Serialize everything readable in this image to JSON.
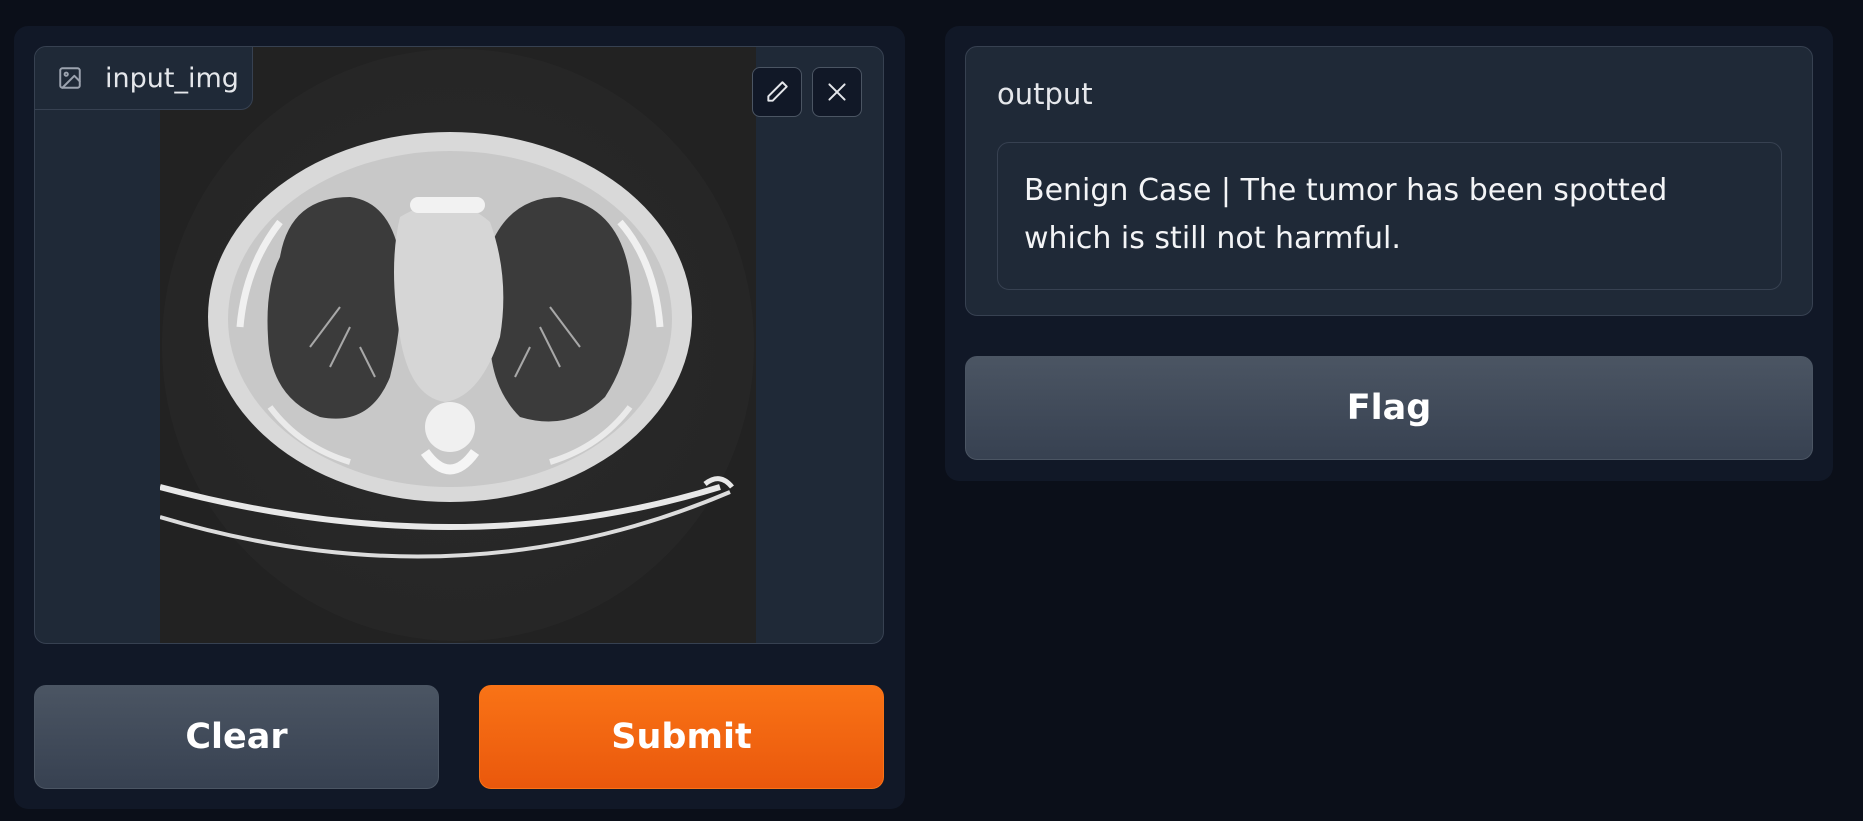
{
  "input": {
    "label": "input_img",
    "icon": "image-icon",
    "tools": [
      {
        "name": "edit",
        "icon": "pencil-icon"
      },
      {
        "name": "close",
        "icon": "close-icon"
      }
    ]
  },
  "buttons": {
    "clear_label": "Clear",
    "submit_label": "Submit",
    "flag_label": "Flag"
  },
  "output": {
    "label": "output",
    "text": "Benign Case | The tumor has been spotted which is still not harmful."
  },
  "colors": {
    "background": "#0b0f19",
    "panel": "#111827",
    "block": "#1f2937",
    "accent": "#f97316",
    "secondary_button": "#4b5563"
  }
}
